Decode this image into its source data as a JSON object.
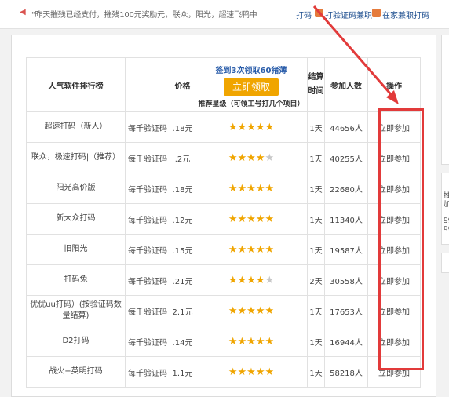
{
  "topbar": {
    "notice": "\"昨天摧残已经支付，摧残100元奖励元，联众，阳光，超速飞鸭中",
    "links": [
      "打码",
      "打验证码兼职",
      "在家兼职打码"
    ]
  },
  "table": {
    "headers": {
      "software": "人气软件排行榜",
      "price": "价格",
      "sign_title": "签到3次领取60猪薄",
      "get_button": "立即领取",
      "recommend": "推荐星级（可领工号打几个项目）",
      "settle": "结算时间",
      "participants": "参加人数",
      "action": "操作"
    },
    "rows": [
      {
        "name": "超速打码（新人）",
        "unit": "每千验证码",
        "price": ".18元",
        "stars": 5,
        "settle": "1天",
        "count": "44656人",
        "action": "立即参加"
      },
      {
        "name": "联众，极速打码|（推荐）",
        "unit": "每千验证码",
        "price": ".2元",
        "stars": 4,
        "settle": "1天",
        "count": "40255人",
        "action": "立即参加"
      },
      {
        "name": "阳光高价版",
        "unit": "每千验证码",
        "price": ".18元",
        "stars": 5,
        "settle": "1天",
        "count": "22680人",
        "action": "立即参加"
      },
      {
        "name": "新大众打码",
        "unit": "每千验证码",
        "price": ".12元",
        "stars": 5,
        "settle": "1天",
        "count": "11340人",
        "action": "立即参加"
      },
      {
        "name": "旧阳光",
        "unit": "每千验证码",
        "price": ".15元",
        "stars": 5,
        "settle": "1天",
        "count": "19587人",
        "action": "立即参加"
      },
      {
        "name": "打码兔",
        "unit": "每千验证码",
        "price": ".21元",
        "stars": 4,
        "settle": "2天",
        "count": "30558人",
        "action": "立即参加"
      },
      {
        "name": "优优uu打码）(按验证码数量结算)",
        "unit": "每千验证码",
        "price": "2.1元",
        "stars": 5,
        "settle": "1天",
        "count": "17653人",
        "action": "立即参加"
      },
      {
        "name": "D2打码",
        "unit": "每千验证码",
        "price": ".14元",
        "stars": 5,
        "settle": "1天",
        "count": "16944人",
        "action": "立即参加"
      },
      {
        "name": "战火+英明打码",
        "unit": "每千验证码",
        "price": "1.1元",
        "stars": 5,
        "settle": "1天",
        "count": "58218人",
        "action": "立即参加"
      }
    ]
  },
  "right_stub": {
    "text1": "推",
    "text2": "加",
    "text3": "gg",
    "text4": "gg"
  },
  "colors": {
    "accent": "#f0a500",
    "link": "#1d4e8f",
    "annotation": "#e23a3a"
  }
}
